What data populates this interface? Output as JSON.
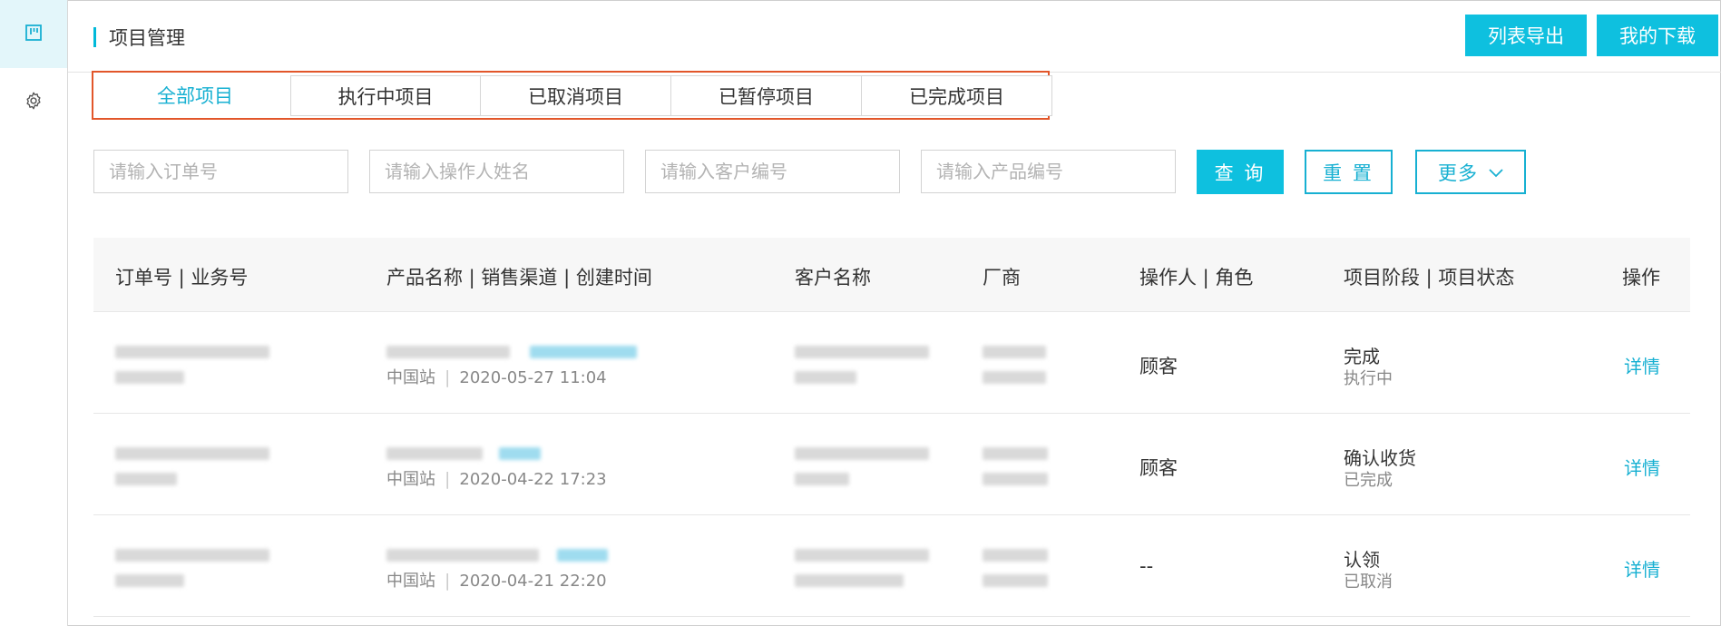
{
  "sidebar": {
    "items": [
      {
        "icon": "kanban-icon",
        "active": true
      },
      {
        "icon": "gear-icon",
        "active": false
      }
    ]
  },
  "header": {
    "title": "项目管理",
    "export_label": "列表导出",
    "download_label": "我的下载"
  },
  "tabs": [
    {
      "label": "全部项目",
      "active": true
    },
    {
      "label": "执行中项目",
      "active": false
    },
    {
      "label": "已取消项目",
      "active": false
    },
    {
      "label": "已暂停项目",
      "active": false
    },
    {
      "label": "已完成项目",
      "active": false
    }
  ],
  "filters": {
    "order_placeholder": "请输入订单号",
    "operator_placeholder": "请输入操作人姓名",
    "customer_placeholder": "请输入客户编号",
    "product_placeholder": "请输入产品编号",
    "query_label": "查 询",
    "reset_label": "重 置",
    "more_label": "更多"
  },
  "table": {
    "columns": [
      "订单号 | 业务号",
      "产品名称 | 销售渠道 | 创建时间",
      "客户名称",
      "厂商",
      "操作人 | 角色",
      "项目阶段 | 项目状态",
      "操作"
    ],
    "rows": [
      {
        "channel": "中国站",
        "created": "2020-05-27 11:04",
        "operator": "顾客",
        "stage": "完成",
        "status": "执行中",
        "action": "详情"
      },
      {
        "channel": "中国站",
        "created": "2020-04-22 17:23",
        "operator": "顾客",
        "stage": "确认收货",
        "status": "已完成",
        "action": "详情"
      },
      {
        "channel": "中国站",
        "created": "2020-04-21 22:20",
        "operator": "--",
        "stage": "认领",
        "status": "已取消",
        "action": "详情"
      }
    ]
  },
  "colors": {
    "accent": "#0ec0df",
    "highlight_border": "#e2562a"
  }
}
